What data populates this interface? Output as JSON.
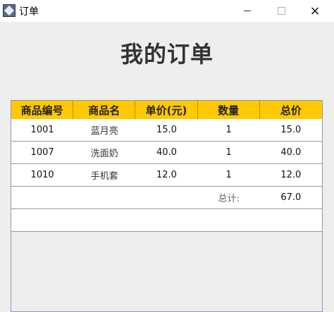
{
  "window": {
    "title": "订单",
    "app_icon": "java-cup-icon",
    "controls": {
      "minimize": "minimize-icon",
      "maximize": "maximize-icon",
      "close": "×"
    }
  },
  "page": {
    "title": "我的订单"
  },
  "table": {
    "header_color": "#ffc800",
    "columns": [
      "商品编号",
      "商品名",
      "单价(元)",
      "数量",
      "总价"
    ],
    "rows": [
      [
        "1001",
        "蓝月亮",
        "15.0",
        "1",
        "15.0"
      ],
      [
        "1007",
        "洗面奶",
        "40.0",
        "1",
        "40.0"
      ],
      [
        "1010",
        "手机套",
        "12.0",
        "1",
        "12.0"
      ]
    ],
    "total_row": {
      "label": "总计:",
      "value": "67.0"
    }
  }
}
